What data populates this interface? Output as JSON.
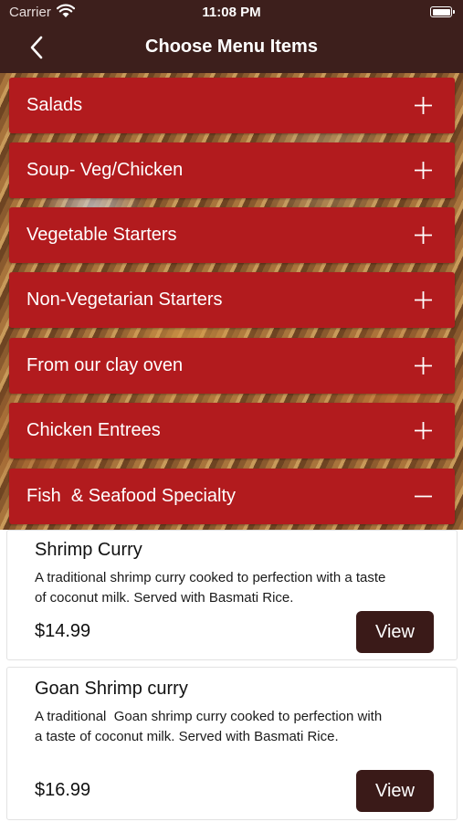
{
  "status_bar": {
    "carrier": "Carrier",
    "time": "11:08 PM"
  },
  "nav": {
    "title": "Choose Menu Items",
    "back_icon": "chevron-left-icon"
  },
  "categories": [
    {
      "label": "Salads",
      "state": "collapsed"
    },
    {
      "label": "Soup- Veg/Chicken",
      "state": "collapsed"
    },
    {
      "label": "Vegetable Starters",
      "state": "collapsed"
    },
    {
      "label": "Non-Vegetarian Starters",
      "state": "collapsed"
    },
    {
      "label": "From our clay oven",
      "state": "collapsed"
    },
    {
      "label": "Chicken Entrees",
      "state": "collapsed"
    },
    {
      "label": "Fish  & Seafood Specialty",
      "state": "expanded"
    }
  ],
  "items": [
    {
      "name": "Shrimp Curry",
      "description": "A traditional shrimp curry cooked to perfection with a taste of coconut milk. Served with Basmati Rice.",
      "price": "$14.99",
      "button_label": "View"
    },
    {
      "name": "Goan Shrimp curry",
      "description": "A traditional  Goan shrimp curry cooked to perfection with a taste of coconut milk. Served with Basmati Rice.",
      "price": "$16.99",
      "button_label": "View"
    }
  ],
  "colors": {
    "nav_background": "#3d1f1c",
    "category_background": "#b21b1e",
    "button_background": "#3a1a18"
  }
}
